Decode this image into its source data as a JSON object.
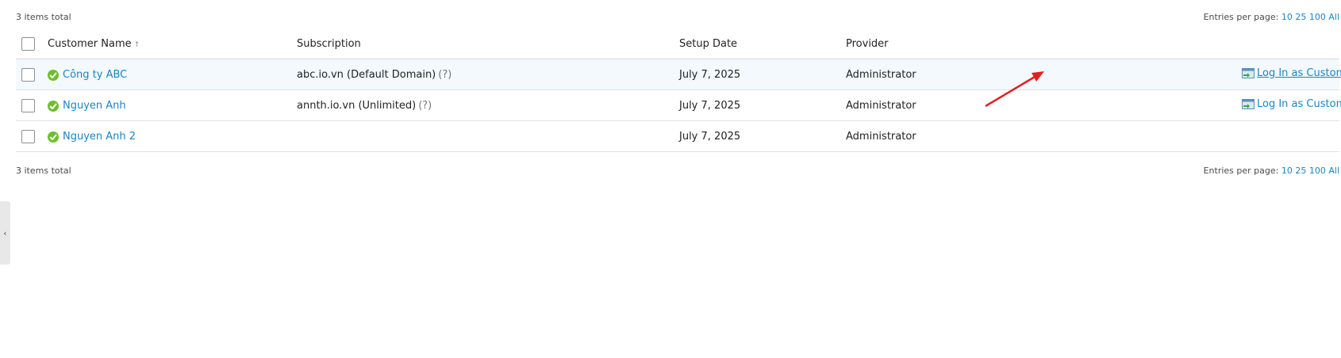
{
  "summary": {
    "total_text": "3 items total"
  },
  "paging": {
    "label": "Entries per page:",
    "options": [
      "10",
      "25",
      "100",
      "All"
    ]
  },
  "table": {
    "headers": {
      "name": "Customer Name",
      "sort_indicator": "↑",
      "subscription": "Subscription",
      "setup_date": "Setup Date",
      "provider": "Provider"
    },
    "rows": [
      {
        "name": "Công ty ABC",
        "subscription": "abc.io.vn (Default Domain)",
        "help": "(?)",
        "setup_date": "July 7, 2025",
        "provider": "Administrator",
        "action": "Log In as Customer"
      },
      {
        "name": "Nguyen Anh",
        "subscription": "annth.io.vn (Unlimited)",
        "help": "(?)",
        "setup_date": "July 7, 2025",
        "provider": "Administrator",
        "action": "Log In as Customer"
      },
      {
        "name": "Nguyen Anh 2",
        "subscription": "",
        "help": "",
        "setup_date": "July 7, 2025",
        "provider": "Administrator",
        "action": ""
      }
    ]
  },
  "side_handle": {
    "glyph": "‹"
  },
  "colors": {
    "link": "#1a85c6",
    "status_ok": "#6cc02b",
    "annotation_arrow": "#e02020"
  }
}
